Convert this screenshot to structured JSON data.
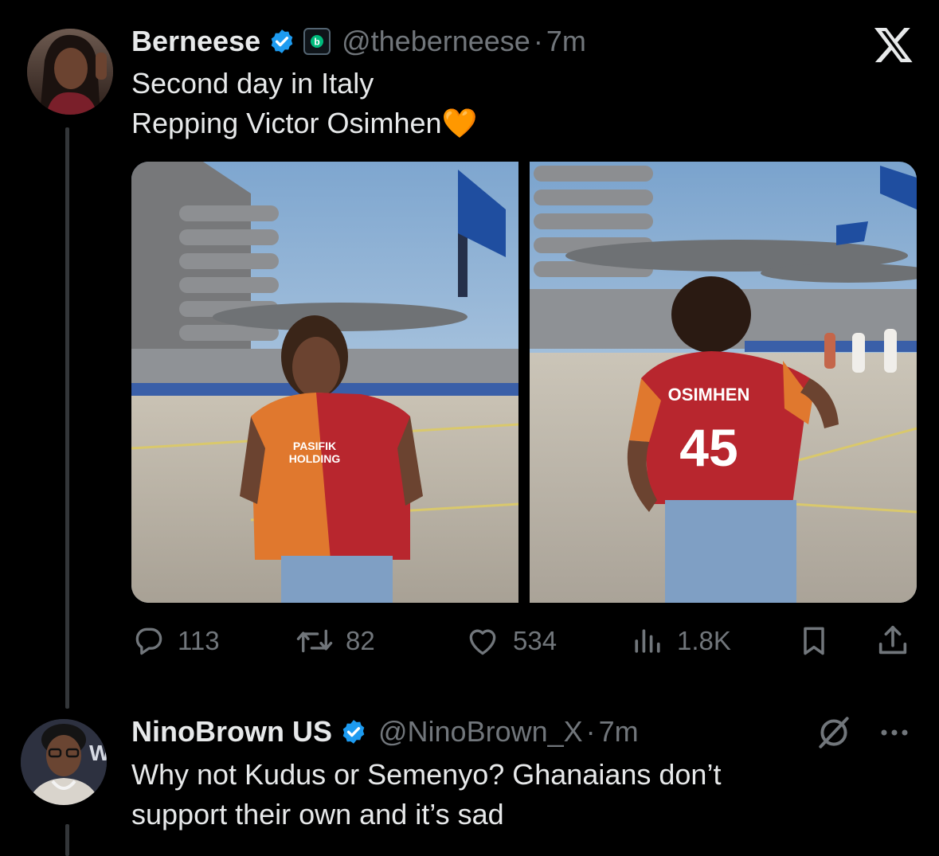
{
  "tweet": {
    "display_name": "Berneese",
    "handle": "@theberneese",
    "separator": "·",
    "time": "7m",
    "line1": "Second day in Italy",
    "line2": "Repping Victor Osimhen",
    "emoji": "🧡",
    "badge_icon": "verified-badge-icon",
    "affiliate_icon": "affiliate-b-icon",
    "logo_icon": "x-logo-icon",
    "photo1_text": [
      "PASIFIK",
      "HOLDING"
    ],
    "photo2_text": [
      "OSIMHEN",
      "45"
    ],
    "actions": {
      "replies": "113",
      "reposts": "82",
      "likes": "534",
      "views": "1.8K"
    }
  },
  "reply": {
    "display_name": "NinoBrown US",
    "handle": "@NinoBrown_X",
    "separator": "·",
    "time": "7m",
    "line1": "Why not Kudus or Semenyo? Ghanaians don’t",
    "line2": "support their own and it’s sad",
    "avatar_text": "W.",
    "menu_icon": "more-dots-icon",
    "grok_icon": "grok-slash-icon"
  },
  "colors": {
    "background": "#000000",
    "text": "#e7e9ea",
    "muted": "#71767b",
    "verified_blue": "#1d9bf0",
    "affiliate_green": "#00ba7c"
  }
}
